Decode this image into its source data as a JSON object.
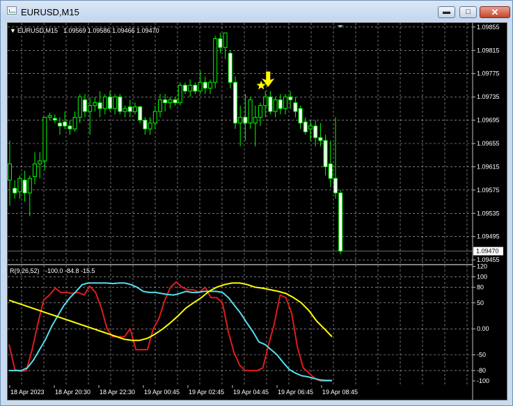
{
  "window": {
    "title": "EURUSD,M15",
    "min_glyph": "▬",
    "max_glyph": "□",
    "close_glyph": "✕"
  },
  "chart_header": {
    "menu_glyph": "▼",
    "symbol": "EURUSD,M15",
    "ohlc": "1.09569 1.09586 1.09466 1.09470"
  },
  "indicator_header": {
    "name": "R(9,26,52)",
    "values": "-100.0 -84.8 -15.5"
  },
  "colors": {
    "background": "#000000",
    "grid": "#c0c0c0",
    "candle": "#00ff00",
    "signal": "#ffff00",
    "red_line": "#e01c1c",
    "cyan_line": "#55e0ee",
    "yellow_line": "#ffff00"
  },
  "icons": {
    "signal_arrow": "down-arrow-icon",
    "signal_star": "star-icon"
  },
  "chart_data": [
    {
      "type": "candlestick",
      "symbol": "EURUSD",
      "timeframe": "M15",
      "price_ticks": [
        "1.09855",
        "1.09815",
        "1.09775",
        "1.09735",
        "1.09695",
        "1.09655",
        "1.09615",
        "1.09575",
        "1.09535",
        "1.09495",
        "1.09455"
      ],
      "current_price_label": "1.09470",
      "ylim": [
        1.09448,
        1.09862
      ],
      "time_ticks": [
        "18 Apr 2023",
        "18 Apr 20:30",
        "18 Apr 22:30",
        "19 Apr 00:45",
        "19 Apr 02:45",
        "19 Apr 04:45",
        "19 Apr 06:45",
        "19 Apr 08:45"
      ],
      "ohlc": [
        [
          1.09592,
          1.0966,
          1.09548,
          1.0962
        ],
        [
          1.09578,
          1.09592,
          1.0956,
          1.0957
        ],
        [
          1.09572,
          1.096,
          1.0956,
          1.09595
        ],
        [
          1.09592,
          1.09608,
          1.09555,
          1.0957
        ],
        [
          1.0957,
          1.096,
          1.0953,
          1.09595
        ],
        [
          1.09598,
          1.0964,
          1.09585,
          1.0962
        ],
        [
          1.0962,
          1.0964,
          1.09595,
          1.09625
        ],
        [
          1.09625,
          1.097,
          1.0961,
          1.097
        ],
        [
          1.097,
          1.09708,
          1.09695,
          1.09703
        ],
        [
          1.09698,
          1.09705,
          1.0969,
          1.09695
        ],
        [
          1.0969,
          1.097,
          1.0967,
          1.09685
        ],
        [
          1.09692,
          1.0971,
          1.0968,
          1.09685
        ],
        [
          1.09685,
          1.09695,
          1.0967,
          1.0968
        ],
        [
          1.0968,
          1.0971,
          1.09675,
          1.097
        ],
        [
          1.097,
          1.0974,
          1.0969,
          1.09735
        ],
        [
          1.0973,
          1.0974,
          1.097,
          1.0971
        ],
        [
          1.0971,
          1.09735,
          1.0967,
          1.0972
        ],
        [
          1.0972,
          1.09735,
          1.0971,
          1.09725
        ],
        [
          1.09725,
          1.09745,
          1.097,
          1.09715
        ],
        [
          1.09715,
          1.0974,
          1.09705,
          1.09735
        ],
        [
          1.09735,
          1.09745,
          1.0971,
          1.09715
        ],
        [
          1.09715,
          1.0974,
          1.09705,
          1.09735
        ],
        [
          1.09735,
          1.0974,
          1.09705,
          1.0971
        ],
        [
          1.0971,
          1.0972,
          1.097,
          1.09715
        ],
        [
          1.09718,
          1.0973,
          1.097,
          1.0971
        ],
        [
          1.0971,
          1.09725,
          1.09705,
          1.09718
        ],
        [
          1.09718,
          1.0972,
          1.0969,
          1.09695
        ],
        [
          1.09695,
          1.097,
          1.0967,
          1.0968
        ],
        [
          1.0968,
          1.097,
          1.0967,
          1.0969
        ],
        [
          1.0969,
          1.0972,
          1.0968,
          1.0971
        ],
        [
          1.0971,
          1.0974,
          1.097,
          1.0973
        ],
        [
          1.0973,
          1.0974,
          1.0971,
          1.09725
        ],
        [
          1.09725,
          1.09735,
          1.09715,
          1.0973
        ],
        [
          1.0973,
          1.09735,
          1.0972,
          1.09725
        ],
        [
          1.09725,
          1.0976,
          1.0972,
          1.09755
        ],
        [
          1.09755,
          1.0976,
          1.0974,
          1.09745
        ],
        [
          1.09745,
          1.09765,
          1.09735,
          1.09755
        ],
        [
          1.09755,
          1.0976,
          1.0974,
          1.09745
        ],
        [
          1.09745,
          1.0978,
          1.0974,
          1.0976
        ],
        [
          1.0976,
          1.0977,
          1.0974,
          1.0975
        ],
        [
          1.0975,
          1.09765,
          1.0974,
          1.0976
        ],
        [
          1.0976,
          1.0984,
          1.0975,
          1.09835
        ],
        [
          1.09835,
          1.09845,
          1.0981,
          1.0982
        ],
        [
          1.0982,
          1.09845,
          1.098,
          1.09845
        ],
        [
          1.0981,
          1.09815,
          1.0975,
          1.0976
        ],
        [
          1.0976,
          1.0977,
          1.0968,
          1.0969
        ],
        [
          1.0969,
          1.0972,
          1.0965,
          1.097
        ],
        [
          1.097,
          1.0974,
          1.0966,
          1.0969
        ],
        [
          1.0969,
          1.09735,
          1.0968,
          1.0973
        ],
        [
          1.0969,
          1.0972,
          1.0965,
          1.097
        ],
        [
          1.097,
          1.09725,
          1.09685,
          1.0972
        ],
        [
          1.0972,
          1.09745,
          1.097,
          1.09735
        ],
        [
          1.09735,
          1.09745,
          1.09705,
          1.0971
        ],
        [
          1.0971,
          1.09735,
          1.097,
          1.0973
        ],
        [
          1.0973,
          1.0974,
          1.09705,
          1.09715
        ],
        [
          1.09715,
          1.0974,
          1.09705,
          1.09735
        ],
        [
          1.09735,
          1.09745,
          1.09715,
          1.0973
        ],
        [
          1.09725,
          1.09735,
          1.097,
          1.0971
        ],
        [
          1.09715,
          1.0972,
          1.0968,
          1.0969
        ],
        [
          1.09692,
          1.097,
          1.0967,
          1.09675
        ],
        [
          1.0968,
          1.09695,
          1.0966,
          1.09685
        ],
        [
          1.09685,
          1.09695,
          1.0965,
          1.09665
        ],
        [
          1.09665,
          1.0969,
          1.0965,
          1.0966
        ],
        [
          1.0966,
          1.0967,
          1.096,
          1.09615
        ],
        [
          1.0962,
          1.0966,
          1.0958,
          1.09595
        ],
        [
          1.09595,
          1.097,
          1.0956,
          1.0957
        ],
        [
          1.0957,
          1.09575,
          1.09465,
          1.0947
        ]
      ],
      "signal": {
        "candle_index": 51,
        "marker": "down-arrow-and-star"
      }
    },
    {
      "type": "line",
      "title": "R(9,26,52)",
      "y_ticks": [
        "120",
        "100",
        "80",
        "50",
        "0.00",
        "-50",
        "-80",
        "-100"
      ],
      "ylim": [
        -108,
        122
      ],
      "series": [
        {
          "color": "#e01c1c",
          "values": [
            -30,
            -78,
            -82,
            -80,
            -40,
            10,
            55,
            65,
            78,
            70,
            70,
            68,
            70,
            65,
            82,
            70,
            40,
            0,
            -15,
            -15,
            -15,
            0,
            -40,
            -40,
            -40,
            0,
            20,
            55,
            80,
            90,
            80,
            75,
            75,
            70,
            80,
            60,
            60,
            50,
            -5,
            -45,
            -70,
            -80,
            -80,
            -80,
            -75,
            -30,
            10,
            65,
            60,
            30,
            -35,
            -75,
            -85,
            -95,
            -100,
            -100,
            -100
          ]
        },
        {
          "color": "#55e0ee",
          "values": [
            -80,
            -80,
            -80,
            -75,
            -60,
            -40,
            -20,
            5,
            25,
            45,
            60,
            72,
            85,
            88,
            88,
            88,
            88,
            87,
            88,
            88,
            85,
            80,
            72,
            70,
            70,
            68,
            66,
            65,
            68,
            72,
            70,
            70,
            72,
            72,
            72,
            70,
            60,
            45,
            30,
            12,
            -5,
            -25,
            -30,
            -40,
            -50,
            -65,
            -78,
            -85,
            -90,
            -92,
            -95,
            -98,
            -99,
            -99
          ]
        },
        {
          "color": "#ffff00",
          "values": [
            55,
            50,
            45,
            40,
            35,
            30,
            25,
            20,
            15,
            10,
            5,
            0,
            -5,
            -10,
            -15,
            -20,
            -22,
            -22,
            -18,
            -10,
            0,
            12,
            25,
            40,
            50,
            60,
            72,
            80,
            85,
            88,
            88,
            85,
            80,
            78,
            75,
            72,
            68,
            60,
            50,
            35,
            15,
            0,
            -15
          ]
        }
      ]
    }
  ]
}
